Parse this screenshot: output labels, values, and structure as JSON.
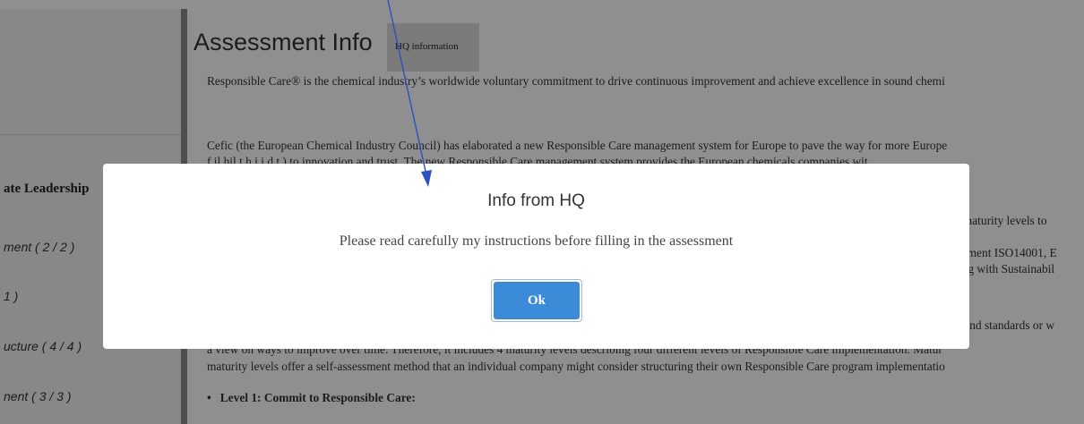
{
  "sidebar": {
    "section_title": "ate Leadership",
    "items": [
      {
        "label": "ment ( 2 / 2 )"
      },
      {
        "label": "1 )"
      },
      {
        "label": "ucture ( 4 / 4 )"
      },
      {
        "label": "nent ( 3 / 3 )"
      }
    ]
  },
  "main": {
    "title": "Assessment Info",
    "hq_info_label": "HQ information",
    "paragraphs": {
      "p1": "Responsible Care® is the chemical industry’s worldwide voluntary commitment to drive continuous improvement and achieve excellence in sound chemi",
      "p2a": "Cefic (the European Chemical Industry Council) has elaborated a new Responsible Care management system for Europe to pave the way for more Europe",
      "p2b": "f      il     hil     t      h      i     i     d      t    ) to innovation and trust. The new Responsible Care management system provides the European chemicals companies wit",
      "p3": "a view on ways to improve over time. Therefore, it includes 4 maturity levels describing four different levels of Responsible Care implementation. Matur",
      "p4": "maturity levels offer a self-assessment method that an individual company might consider structuring their own Responsible Care program implementatio",
      "level1": "Level 1: Commit to Responsible Care:"
    }
  },
  "behind_modal_fragments": {
    "f1": "f maturity levels to",
    "f2": "gement ISO14001, E",
    "f3": "ong with Sustainabil",
    "f4": "e and standards or w"
  },
  "modal": {
    "title": "Info from HQ",
    "message": "Please read carefully my instructions before filling in the assessment",
    "ok_label": "Ok"
  },
  "colors": {
    "accent": "#3b8bd9",
    "arrow": "#2a52be",
    "overlay": "rgba(0,0,0,0.44)"
  }
}
